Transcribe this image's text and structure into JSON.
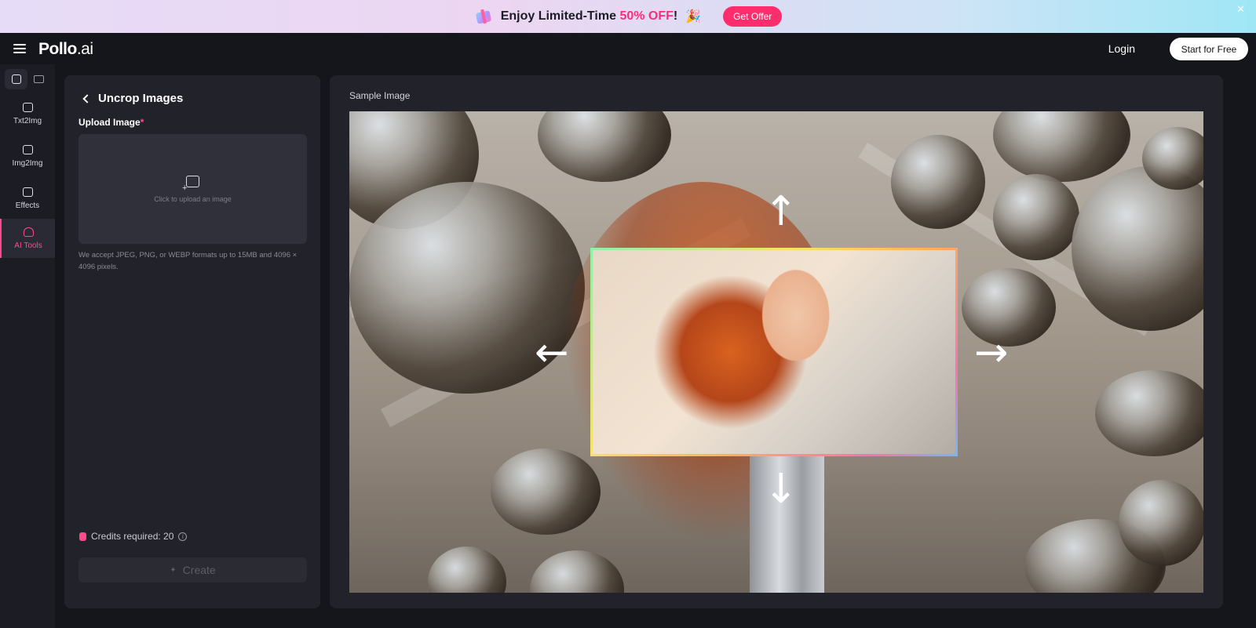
{
  "promo": {
    "text_prefix": "Enjoy Limited-Time ",
    "text_highlight": "50% OFF",
    "text_suffix": "!",
    "button": "Get Offer",
    "close": "✕"
  },
  "nav": {
    "logo_main": "Pollo",
    "logo_suffix": ".ai",
    "login": "Login",
    "start": "Start for Free"
  },
  "rail": {
    "items": [
      {
        "label": "Txt2Img",
        "icon": "image-icon"
      },
      {
        "label": "Img2Img",
        "icon": "image-icon"
      },
      {
        "label": "Effects",
        "icon": "image-icon"
      },
      {
        "label": "AI Tools",
        "icon": "robot-icon",
        "active": true
      }
    ]
  },
  "panel": {
    "title": "Uncrop Images",
    "upload_label": "Upload Image",
    "required_mark": "*",
    "upload_hint": "Click to upload an image",
    "formats": "We accept JPEG, PNG, or WEBP formats up to 15MB and 4096 × 4096 pixels.",
    "credits": "Credits required: 20",
    "create": "Create"
  },
  "sample": {
    "title": "Sample Image"
  },
  "colors": {
    "accent": "#ff2d6e",
    "highlight": "#ff4b8c",
    "background": "#15151c",
    "panel": "#22222b"
  }
}
